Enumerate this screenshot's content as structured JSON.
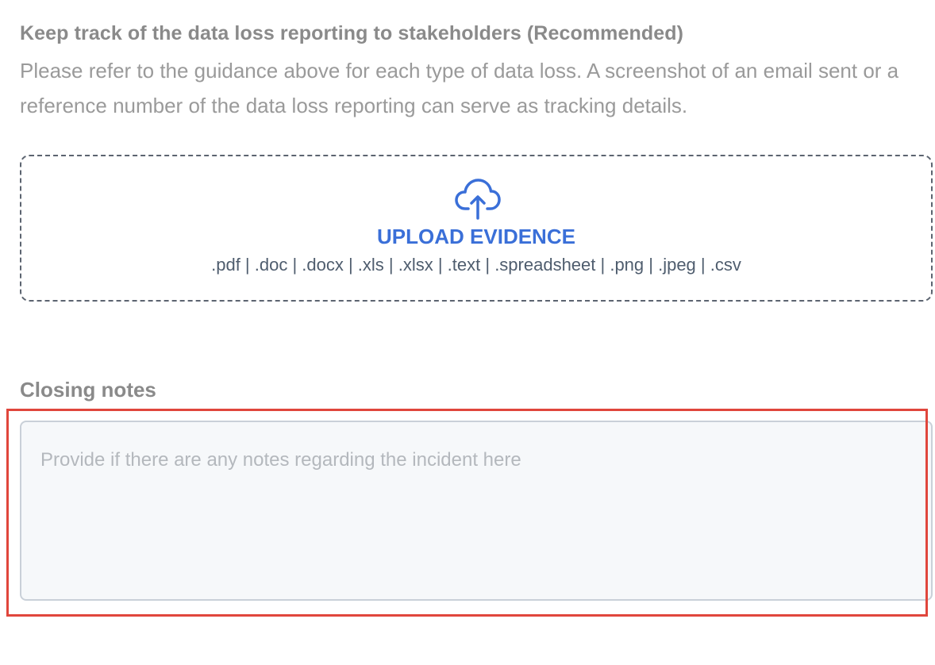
{
  "tracking": {
    "title": "Keep track of the data loss reporting to stakeholders (Recommended)",
    "description": "Please refer to the guidance above for each type of data loss. A screenshot of an email sent or a reference number of the data loss reporting can serve as tracking details."
  },
  "upload": {
    "icon": "cloud-upload-icon",
    "label": "UPLOAD EVIDENCE",
    "formats": ".pdf | .doc | .docx | .xls | .xlsx | .text | .spreadsheet | .png | .jpeg | .csv"
  },
  "closing_notes": {
    "label": "Closing notes",
    "placeholder": "Provide if there are any notes regarding the incident here",
    "value": ""
  },
  "colors": {
    "accent": "#3a6fd8",
    "highlight": "#e0463c",
    "input_background": "#f6f8fa"
  }
}
